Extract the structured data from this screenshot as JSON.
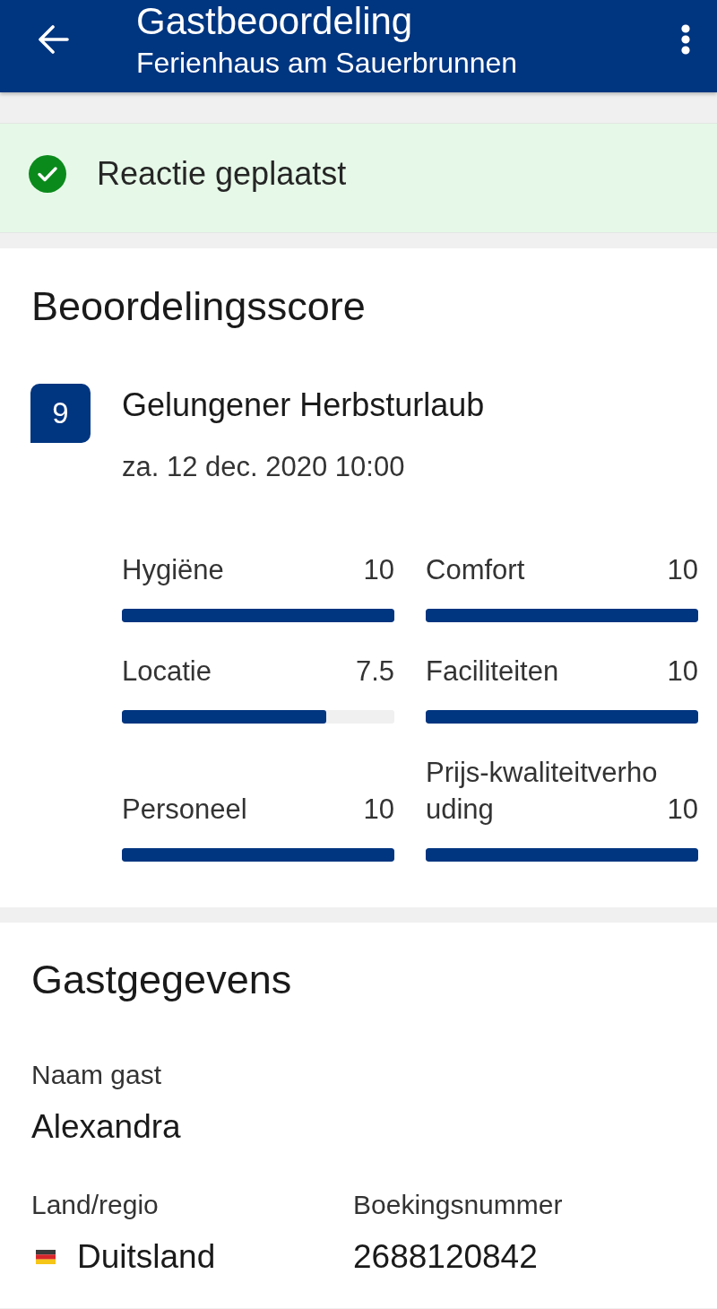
{
  "app_bar": {
    "title": "Gastbeoordeling",
    "subtitle": "Ferienhaus am Sauerbrunnen"
  },
  "banner": {
    "kind": "success",
    "message": "Reactie geplaatst"
  },
  "score_section": {
    "heading": "Beoordelingsscore",
    "review": {
      "score": "9",
      "title": "Gelungener Herbsturlaub",
      "date": "za. 12 dec. 2020 10:00"
    },
    "subscores": [
      {
        "label": "Hygiëne",
        "value": "10",
        "level": 1
      },
      {
        "label": "Locatie",
        "value": "7.5",
        "level": 0.75
      },
      {
        "label": "Personeel",
        "value": "10",
        "level": 1
      },
      {
        "label": "Comfort",
        "value": "10",
        "level": 1
      },
      {
        "label": "Faciliteiten",
        "value": "10",
        "level": 1
      },
      {
        "label": "Prijs-kwaliteitverhouding",
        "value": "10",
        "level": 1
      }
    ]
  },
  "guest_section": {
    "heading": "Gastgegevens",
    "rows": [
      [
        {
          "kind": "text",
          "label": "Naam gast",
          "value": "Alexandra"
        }
      ],
      [
        {
          "kind": "country",
          "label": "Land/regio",
          "value": "Duitsland"
        },
        {
          "kind": "text",
          "label": "Boekingsnummer",
          "value": "2688120842"
        }
      ]
    ]
  }
}
